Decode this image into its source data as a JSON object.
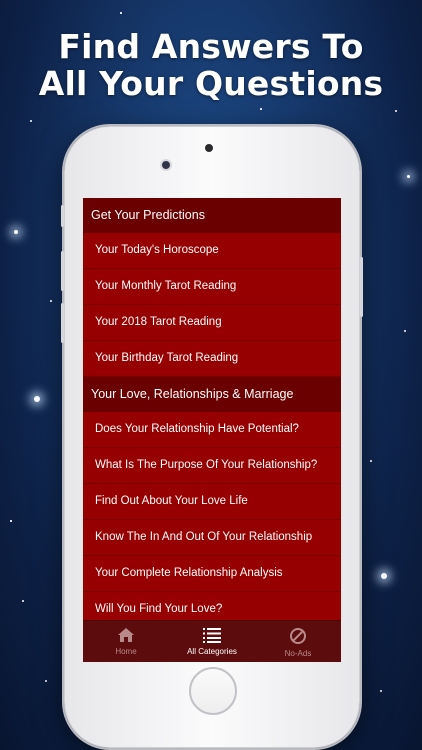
{
  "headline": {
    "line1": "Find Answers To",
    "line2": "All Your Questions"
  },
  "sections": [
    {
      "title": "Get Your Predictions",
      "items": [
        "Your Today's Horoscope",
        "Your Monthly Tarot Reading",
        "Your 2018 Tarot Reading",
        "Your Birthday Tarot Reading"
      ]
    },
    {
      "title": "Your Love, Relationships & Marriage",
      "items": [
        "Does Your Relationship Have Potential?",
        "What Is The Purpose Of Your Relationship?",
        "Find Out About Your Love Life",
        "Know The In And Out Of Your Relationship",
        "Your Complete Relationship Analysis",
        "Will You Find Your Love?"
      ]
    }
  ],
  "tabbar": {
    "tabs": [
      {
        "label": "Home",
        "icon": "home-icon",
        "active": false
      },
      {
        "label": "All Categories",
        "icon": "list-icon",
        "active": true
      },
      {
        "label": "No-Ads",
        "icon": "no-ads-icon",
        "active": false
      }
    ]
  },
  "colors": {
    "section_header": "#6a0000",
    "row": "#960000",
    "tabbar": "#5c0c0c",
    "background": "#173a6e"
  }
}
